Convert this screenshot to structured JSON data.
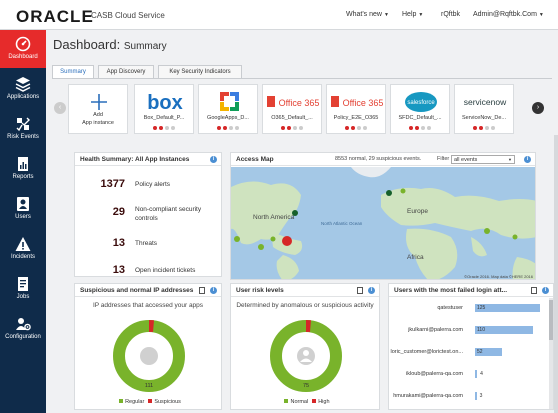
{
  "header": {
    "brand": "ORACLE",
    "product": "CASB Cloud Service",
    "whats_new": "What's new",
    "help": "Help",
    "tenant": "rQftbk",
    "user": "Admin@Rqftbk.Com"
  },
  "sidebar": {
    "items": [
      {
        "label": "Dashboard",
        "icon": "dashboard-icon"
      },
      {
        "label": "Applications",
        "icon": "applications-icon"
      },
      {
        "label": "Risk Events",
        "icon": "risk-events-icon"
      },
      {
        "label": "Reports",
        "icon": "reports-icon"
      },
      {
        "label": "Users",
        "icon": "users-icon"
      },
      {
        "label": "Incidents",
        "icon": "incidents-icon"
      },
      {
        "label": "Jobs",
        "icon": "jobs-icon"
      },
      {
        "label": "Configuration",
        "icon": "configuration-icon"
      }
    ]
  },
  "page": {
    "title_prefix": "Dashboard:",
    "title_suffix": "Summary",
    "tabs": [
      "Summary",
      "App Discovery",
      "Key Security Indicators"
    ]
  },
  "apps": [
    {
      "name": "Add App Instance",
      "line1": "Add",
      "line2": "App instance"
    },
    {
      "name": "Box_Default_P...",
      "logo": "box"
    },
    {
      "name": "GoogleApps_D...",
      "logo": "googleapps"
    },
    {
      "name": "O365_Default_...",
      "logo": "Office 365"
    },
    {
      "name": "Policy_E2E_O365",
      "logo": "Office 365"
    },
    {
      "name": "SFDC_Default_...",
      "logo": "salesforce"
    },
    {
      "name": "ServiceNow_De...",
      "logo": "servicenow"
    }
  ],
  "health": {
    "title": "Health Summary: All App Instances",
    "metrics": [
      {
        "value": "1377",
        "label": "Policy alerts"
      },
      {
        "value": "29",
        "label": "Non-compliant security controls"
      },
      {
        "value": "13",
        "label": "Threats"
      },
      {
        "value": "13",
        "label": "Open incident tickets"
      }
    ]
  },
  "access_map": {
    "title": "Access Map",
    "summary": "8553 normal, 29 suspicious events.",
    "filter_label": "Filter",
    "filter_value": "all events",
    "labels": [
      "North America",
      "North Atlantic Ocean",
      "Europe",
      "Africa"
    ],
    "attribution": "©Oracle 2016. Map data ©HERE 2016"
  },
  "ip_panel": {
    "title": "Suspicious and normal IP addresses",
    "subtitle": "IP addresses that accessed your apps",
    "center_value": "111",
    "regular": 111,
    "suspicious": 3,
    "legend": [
      "Regular",
      "Suspicious"
    ]
  },
  "risk_panel": {
    "title": "User risk levels",
    "subtitle": "Determined by anomalous or suspicious activity",
    "center_value": "75",
    "normal": 75,
    "high": 2,
    "legend": [
      "Normal",
      "High"
    ]
  },
  "failed_logins": {
    "title": "Users with the most failed login att...",
    "rows": [
      {
        "user": "qatestuser",
        "value": 125
      },
      {
        "user": "jkulkarni@palerra.com",
        "value": 110
      },
      {
        "user": "loric_customer@lorictest.on...",
        "value": 52
      },
      {
        "user": "ikloub@palerra-qa.com",
        "value": 4
      },
      {
        "user": "hmurakami@palerra-qa.com",
        "value": 3
      }
    ],
    "max": 130
  },
  "colors": {
    "accent_red": "#e62b2b",
    "sidebar": "#0f2b4a",
    "ring_green": "#79b32b",
    "ring_red": "#d62728",
    "bar_blue": "#8fb8e4"
  }
}
